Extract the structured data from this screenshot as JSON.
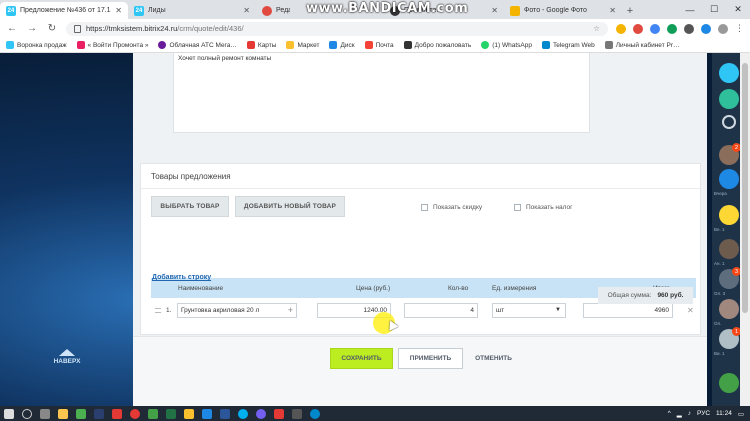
{
  "browser": {
    "tabs": [
      {
        "label": "Предложение №436 от 17.1…",
        "favicon": "bitrix24-icon",
        "active": true
      },
      {
        "label": "Лиды",
        "favicon": "bitrix24-icon",
        "active": false
      },
      {
        "label": "Редактир…",
        "favicon": "red-circle-icon",
        "active": false
      },
      {
        "label": "Промонте…",
        "favicon": "dark-circle-icon",
        "active": false
      },
      {
        "label": "Фото - Google Фото",
        "favicon": "google-photos-icon",
        "active": false
      }
    ],
    "watermark": "www.BANDICAM.com",
    "url_host": "https://tmksistem.bitrix24.ru",
    "url_path": "/crm/quote/edit/436/",
    "bookmarks": [
      "Воронка продаж",
      "« Войти Промонта »",
      "Облачная АТС Мега…",
      "Карты",
      "Маркет",
      "Диск",
      "Почта",
      "Добро пожаловать",
      "(1) WhatsApp",
      "Telegram Web",
      "Личный кабинет Pr…"
    ]
  },
  "form": {
    "description_text": "Хочет полный ремонт комнаты",
    "products_section_title": "Товары предложения",
    "select_product_btn": "ВЫБРАТЬ ТОВАР",
    "add_new_product_btn": "ДОБАВИТЬ НОВЫЙ ТОВАР",
    "show_discount_label": "Показать скидку",
    "show_tax_label": "Показать налог",
    "table": {
      "headers": {
        "name": "Наименование",
        "price": "Цена (руб.)",
        "qty": "Кол-во",
        "unit": "Ед. измерения",
        "total": "Итого"
      },
      "rows": [
        {
          "num": "1.",
          "name": "Грунтовка акриловая 20 л",
          "price": "1240.00",
          "qty": "4",
          "unit": "шт",
          "total": "4960"
        }
      ]
    },
    "add_row_link": "Добавить строку",
    "total_label": "Общая сумма:",
    "total_value": "960 руб.",
    "save_btn": "СОХРАНИТЬ",
    "apply_btn": "ПРИМЕНИТЬ",
    "cancel_btn": "ОТМЕНИТЬ",
    "nav_top_label": "НАВЕРХ"
  },
  "sidebar": {
    "badges": [
      "2",
      "3",
      "1",
      "1"
    ],
    "labels": [
      "Вчера",
      "Ве. 1",
      "Ан. 1",
      "Ол. 3",
      "Ол.",
      "Ви. 1"
    ]
  },
  "taskbar": {
    "lang": "РУС",
    "time": "11:24"
  },
  "colors": {
    "accent_green": "#bbed21",
    "header_blue": "#c8e3f5",
    "link_blue": "#2067b0",
    "bitrix_cyan": "#2fc6f6"
  }
}
